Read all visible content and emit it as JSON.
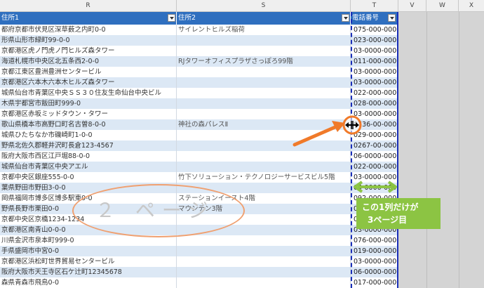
{
  "sheet": {
    "column_letters": [
      "R",
      "S",
      "T",
      "V",
      "W",
      "X"
    ],
    "table_headers": [
      "住所1",
      "住所2",
      "電話番号"
    ],
    "rows": [
      {
        "addr1": "都府京都市伏見区深草薮之内町0-0",
        "addr2": "サイレントヒルズ稲荷",
        "phone": "075-000-0000"
      },
      {
        "addr1": "形県山形市緑町99-0-0",
        "addr2": "",
        "phone": "023-000-0000"
      },
      {
        "addr1": "京都港区虎ノ門虎ノ門ヒルズ森タワー",
        "addr2": "",
        "phone": "03-0000-0000"
      },
      {
        "addr1": "海道札幌市中央区北五条西2-0-0",
        "addr2": "RJタワーオフィスプラザさっぽろ99階",
        "phone": "011-000-0000"
      },
      {
        "addr1": "京都江東区豊洲豊洲センタービル",
        "addr2": "",
        "phone": "03-0000-0000"
      },
      {
        "addr1": "京都港区六本木六本木ヒルズ森タワー",
        "addr2": "",
        "phone": "03-0000-0000"
      },
      {
        "addr1": "城県仙台市青葉区中央ＳＳ３０住友生命仙台中央ビル",
        "addr2": "",
        "phone": "022-000-0000"
      },
      {
        "addr1": "木県宇都宮市飯田町999-0",
        "addr2": "",
        "phone": "028-000-0000"
      },
      {
        "addr1": "京都港区赤坂ミッドタウン・タワー",
        "addr2": "",
        "phone": "03-0000-0000"
      },
      {
        "addr1": "歌山県橋本市高野口町名古曽8-0-0",
        "addr2": "神社の森パレスⅡ",
        "phone": "0736-00-0000"
      },
      {
        "addr1": "城県ひたちなか市磯崎町1-0-0",
        "addr2": "",
        "phone": "029-000-0000"
      },
      {
        "addr1": "野県北佐久郡軽井沢町長倉123-4567",
        "addr2": "",
        "phone": "0267-00-0000"
      },
      {
        "addr1": "阪府大阪市西区江戸堀88-0-0",
        "addr2": "",
        "phone": "06-0000-0000"
      },
      {
        "addr1": "城県仙台市青葉区中央アエル",
        "addr2": "",
        "phone": "022-000-0000"
      },
      {
        "addr1": "京都中央区銀座555-0-0",
        "addr2": "竹下ソリューション・テクノロジーサービスビル5階",
        "phone": "03-0000-0000"
      },
      {
        "addr1": "葉県野田市野田3-0-0",
        "addr2": "",
        "phone": "04-0000-0000"
      },
      {
        "addr1": "岡県福岡市博多区博多駅東0-0",
        "addr2": "ステーションイースト4階",
        "phone": "092-000-0000"
      },
      {
        "addr1": "野県長野市栗田0-0",
        "addr2": "マウンテン3階",
        "phone": "026-000-0000"
      },
      {
        "addr1": "京都中央区京橋1234-1234",
        "addr2": "",
        "phone": "03-0000-0000"
      },
      {
        "addr1": "京都港区南青山0-0-0",
        "addr2": "",
        "phone": "03-0000-0000"
      },
      {
        "addr1": "川県金沢市泉本町999-0",
        "addr2": "",
        "phone": "076-000-0000"
      },
      {
        "addr1": "手県盛岡市中宮0-0",
        "addr2": "",
        "phone": "019-000-0000"
      },
      {
        "addr1": "京都港区浜松町世界貿易センタービル",
        "addr2": "",
        "phone": "03-0000-0000"
      },
      {
        "addr1": "阪府大阪市天王寺区石ケ辻町12345678",
        "addr2": "",
        "phone": "06-0000-0000"
      },
      {
        "addr1": "森県青森市飛鳥0-0",
        "addr2": "",
        "phone": "017-000-0000"
      }
    ]
  },
  "annotations": {
    "page_label": "２ ページ",
    "note_line1": "この1列だけが",
    "note_line2": "3ページ目"
  },
  "colors": {
    "header_blue": "#2f6fbf",
    "row_band": "#dce8f5",
    "page_break_blue": "#1a2fb8",
    "orange": "#f07a2a",
    "green": "#8cc443"
  }
}
